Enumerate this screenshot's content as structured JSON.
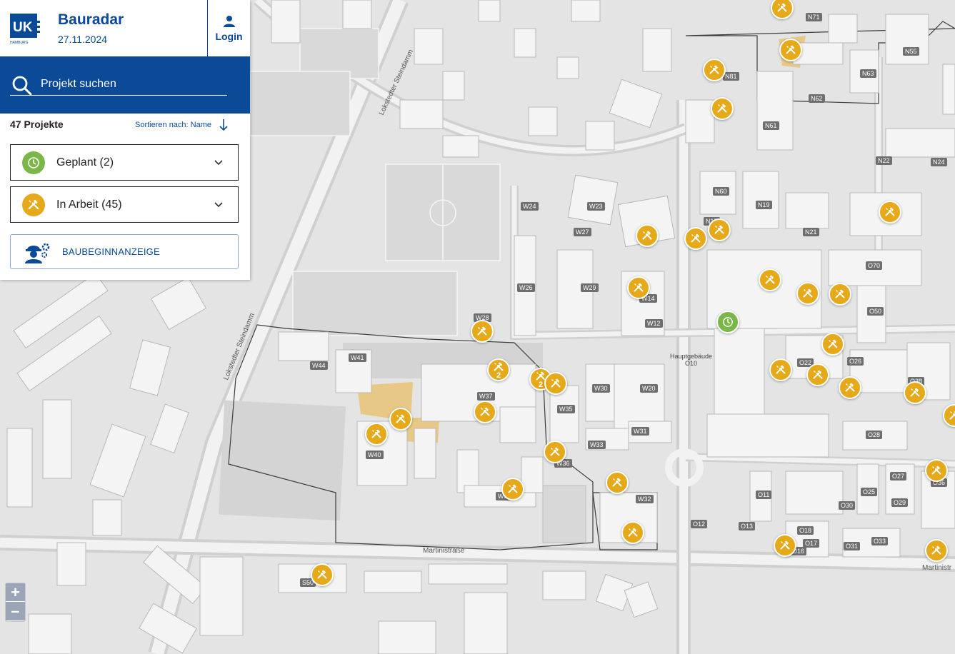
{
  "app": {
    "title": "Bauradar",
    "date": "27.11.2024",
    "logo_text": "UK",
    "logo_sub": "HAMBURG",
    "login_label": "Login"
  },
  "search": {
    "placeholder": "Projekt suchen"
  },
  "list": {
    "count_label": "47 Projekte",
    "sort_label": "Sortieren nach: Name"
  },
  "groups": [
    {
      "label": "Geplant (2)",
      "status": "planned",
      "color": "#7ab648",
      "icon": "clock-icon"
    },
    {
      "label": "In Arbeit (45)",
      "status": "in-progress",
      "color": "#e6a919",
      "icon": "hammer-icon"
    }
  ],
  "baubeginn_label": "BAUBEGINNANZEIGE",
  "zoom": {
    "in": "+",
    "out": "–"
  },
  "colors": {
    "brand": "#0a4a96",
    "in_progress": "#e6a919",
    "planned": "#7ab648"
  },
  "street_labels": [
    "Lokstedter Steindamm",
    "Lokstedter Steindamm",
    "Martinistraße",
    "Martinistr"
  ],
  "poi_labels": [
    "Hauptgebäude",
    "O10"
  ],
  "building_labels": [
    "N71",
    "N55",
    "N81",
    "N63",
    "N62",
    "N61",
    "N22",
    "N24",
    "N60",
    "N19",
    "N17",
    "N21",
    "W24",
    "W23",
    "W27",
    "W26",
    "W29",
    "W14",
    "W12",
    "W28",
    "O70",
    "O50",
    "W41",
    "W44",
    "W37",
    "W35",
    "W30",
    "W20",
    "O22",
    "O26",
    "O38",
    "W40",
    "W33",
    "W31",
    "O28",
    "W36",
    "W38",
    "O27",
    "O36",
    "O11",
    "O25",
    "O29",
    "W32",
    "O30",
    "O12",
    "O13",
    "O18",
    "O17",
    "O16",
    "O31",
    "O33",
    "S50"
  ],
  "markers": [
    {
      "status": "in-progress",
      "count": ""
    },
    {
      "status": "in-progress",
      "count": ""
    },
    {
      "status": "in-progress",
      "count": ""
    },
    {
      "status": "in-progress",
      "count": ""
    },
    {
      "status": "in-progress",
      "count": ""
    },
    {
      "status": "in-progress",
      "count": ""
    },
    {
      "status": "in-progress",
      "count": ""
    },
    {
      "status": "in-progress",
      "count": ""
    },
    {
      "status": "in-progress",
      "count": ""
    },
    {
      "status": "in-progress",
      "count": ""
    },
    {
      "status": "in-progress",
      "count": ""
    },
    {
      "status": "in-progress",
      "count": ""
    },
    {
      "status": "planned",
      "count": ""
    },
    {
      "status": "in-progress",
      "count": ""
    },
    {
      "status": "in-progress",
      "count": ""
    },
    {
      "status": "in-progress",
      "count": ""
    },
    {
      "status": "in-progress",
      "count": ""
    },
    {
      "status": "in-progress",
      "count": "2"
    },
    {
      "status": "in-progress",
      "count": "2"
    },
    {
      "status": "in-progress",
      "count": ""
    },
    {
      "status": "in-progress",
      "count": ""
    },
    {
      "status": "in-progress",
      "count": ""
    },
    {
      "status": "in-progress",
      "count": ""
    },
    {
      "status": "in-progress",
      "count": ""
    },
    {
      "status": "in-progress",
      "count": ""
    },
    {
      "status": "in-progress",
      "count": ""
    },
    {
      "status": "in-progress",
      "count": ""
    },
    {
      "status": "in-progress",
      "count": ""
    },
    {
      "status": "in-progress",
      "count": ""
    },
    {
      "status": "in-progress",
      "count": ""
    },
    {
      "status": "in-progress",
      "count": ""
    },
    {
      "status": "in-progress",
      "count": ""
    },
    {
      "status": "in-progress",
      "count": ""
    },
    {
      "status": "in-progress",
      "count": ""
    },
    {
      "status": "in-progress",
      "count": ""
    },
    {
      "status": "in-progress",
      "count": ""
    }
  ]
}
